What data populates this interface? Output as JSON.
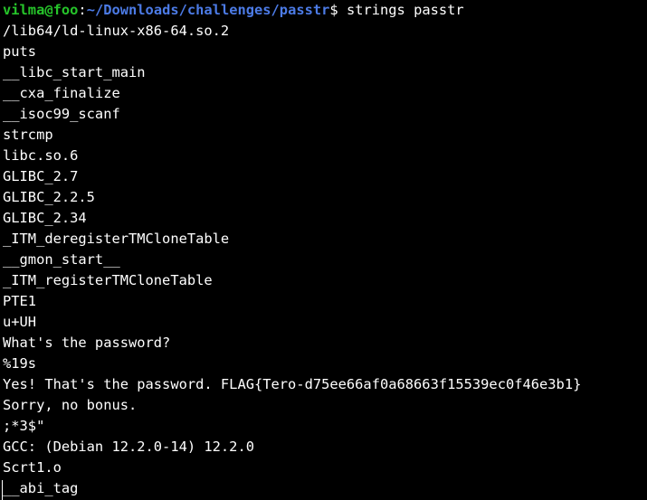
{
  "colors": {
    "background": "#000000",
    "foreground": "#ffffff",
    "prompt_user": "#26c42a",
    "prompt_path": "#4c7be6"
  },
  "prompt": {
    "user_host": "vilma@foo",
    "separator": ":",
    "path": "~/Downloads/challenges/passtr",
    "symbol": "$",
    "command": " strings passtr"
  },
  "output": [
    "/lib64/ld-linux-x86-64.so.2",
    "puts",
    "__libc_start_main",
    "__cxa_finalize",
    "__isoc99_scanf",
    "strcmp",
    "libc.so.6",
    "GLIBC_2.7",
    "GLIBC_2.2.5",
    "GLIBC_2.34",
    "_ITM_deregisterTMCloneTable",
    "__gmon_start__",
    "_ITM_registerTMCloneTable",
    "PTE1",
    "u+UH",
    "What's the password?",
    "%19s",
    "Yes! That's the password. FLAG{Tero-d75ee66af0a68663f15539ec0f46e3b1}",
    "Sorry, no bonus.",
    ";*3$\"",
    "GCC: (Debian 12.2.0-14) 12.2.0",
    "Scrt1.o",
    "__abi_tag"
  ]
}
